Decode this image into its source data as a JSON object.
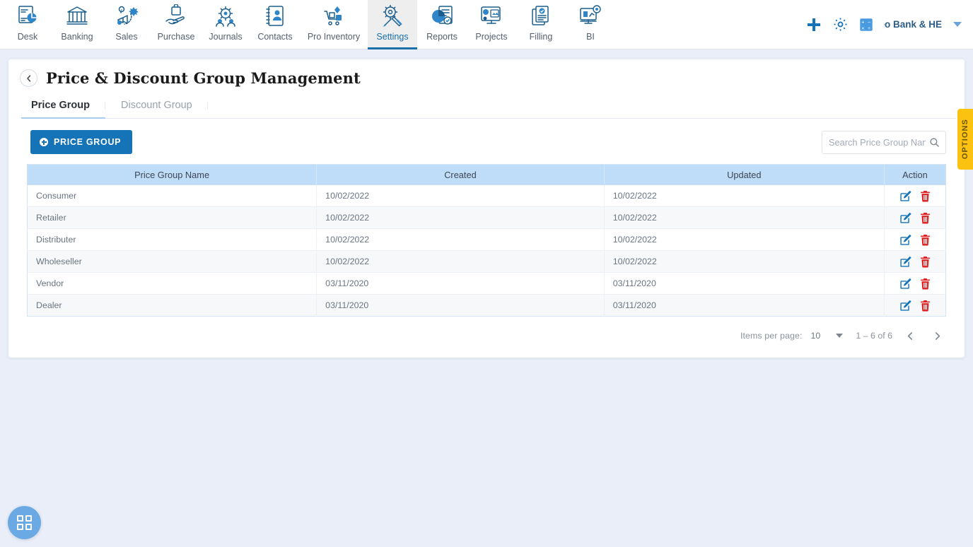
{
  "topnav": {
    "items": [
      {
        "label": "Desk",
        "icon": "desk-dashboard-icon",
        "active": false
      },
      {
        "label": "Banking",
        "icon": "bank-building-icon",
        "active": false
      },
      {
        "label": "Sales",
        "icon": "sales-megaphone-icon",
        "active": false
      },
      {
        "label": "Purchase",
        "icon": "purchase-hand-bag-icon",
        "active": false
      },
      {
        "label": "Journals",
        "icon": "journals-gear-people-icon",
        "active": false
      },
      {
        "label": "Contacts",
        "icon": "contacts-book-icon",
        "active": false
      },
      {
        "label": "Pro Inventory",
        "icon": "inventory-cart-icon",
        "active": false
      },
      {
        "label": "Settings",
        "icon": "settings-tools-icon",
        "active": true
      },
      {
        "label": "Reports",
        "icon": "reports-piechart-icon",
        "active": false
      },
      {
        "label": "Projects",
        "icon": "projects-screen-icon",
        "active": false
      },
      {
        "label": "Filling",
        "icon": "filling-documents-icon",
        "active": false
      },
      {
        "label": "BI",
        "icon": "bi-monitor-icon",
        "active": false
      }
    ],
    "actions": {
      "add_icon": "plus-icon",
      "settings_icon": "gear-icon",
      "calculator_icon": "calculator-icon",
      "company_name": "eo Bank & HE",
      "caret_icon": "chevron-down-icon"
    }
  },
  "page": {
    "back_icon": "chevron-left-icon",
    "title": "Price & Discount Group Management",
    "options_tab_label": "OPTIONS"
  },
  "tabs": [
    {
      "label": "Price Group",
      "active": true
    },
    {
      "label": "Discount Group",
      "active": false
    }
  ],
  "toolbar": {
    "add_button_label": "PRICE GROUP",
    "add_button_icon": "plus-circle-icon",
    "search_placeholder": "Search Price Group Name",
    "search_value": "",
    "search_icon": "search-icon"
  },
  "table": {
    "columns": [
      "Price Group Name",
      "Created",
      "Updated",
      "Action"
    ],
    "row_actions": {
      "edit_icon": "edit-pencil-icon",
      "delete_icon": "trash-icon"
    },
    "rows": [
      {
        "name": "Consumer",
        "created": "10/02/2022",
        "updated": "10/02/2022"
      },
      {
        "name": "Retailer",
        "created": "10/02/2022",
        "updated": "10/02/2022"
      },
      {
        "name": "Distributer",
        "created": "10/02/2022",
        "updated": "10/02/2022"
      },
      {
        "name": "Wholeseller",
        "created": "10/02/2022",
        "updated": "10/02/2022"
      },
      {
        "name": "Vendor",
        "created": "03/11/2020",
        "updated": "03/11/2020"
      },
      {
        "name": "Dealer",
        "created": "03/11/2020",
        "updated": "03/11/2020"
      }
    ]
  },
  "paginator": {
    "items_per_page_label": "Items per page:",
    "items_per_page_value": "10",
    "range_label": "1 – 6 of 6",
    "prev_icon": "chevron-left-icon",
    "next_icon": "chevron-right-icon"
  },
  "fab": {
    "icon": "apps-grid-icon"
  },
  "colors": {
    "accent": "#1573b8",
    "page_bg": "#e9eef8",
    "table_header_bg": "#bfdcf8",
    "options_tab": "#fcc211",
    "delete_icon": "#e02020",
    "edit_icon": "#1573b8",
    "fab_bg": "#6aa9e4"
  }
}
